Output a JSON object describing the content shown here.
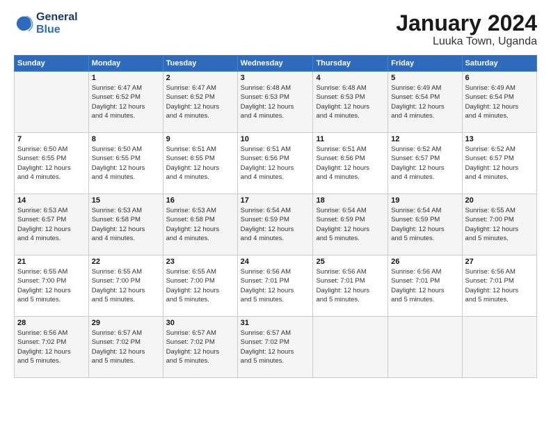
{
  "header": {
    "logo_line1": "General",
    "logo_line2": "Blue",
    "title": "January 2024",
    "subtitle": "Luuka Town, Uganda"
  },
  "days_of_week": [
    "Sunday",
    "Monday",
    "Tuesday",
    "Wednesday",
    "Thursday",
    "Friday",
    "Saturday"
  ],
  "weeks": [
    [
      {
        "day": "",
        "info": ""
      },
      {
        "day": "1",
        "info": "Sunrise: 6:47 AM\nSunset: 6:52 PM\nDaylight: 12 hours\nand 4 minutes."
      },
      {
        "day": "2",
        "info": "Sunrise: 6:47 AM\nSunset: 6:52 PM\nDaylight: 12 hours\nand 4 minutes."
      },
      {
        "day": "3",
        "info": "Sunrise: 6:48 AM\nSunset: 6:53 PM\nDaylight: 12 hours\nand 4 minutes."
      },
      {
        "day": "4",
        "info": "Sunrise: 6:48 AM\nSunset: 6:53 PM\nDaylight: 12 hours\nand 4 minutes."
      },
      {
        "day": "5",
        "info": "Sunrise: 6:49 AM\nSunset: 6:54 PM\nDaylight: 12 hours\nand 4 minutes."
      },
      {
        "day": "6",
        "info": "Sunrise: 6:49 AM\nSunset: 6:54 PM\nDaylight: 12 hours\nand 4 minutes."
      }
    ],
    [
      {
        "day": "7",
        "info": "Sunrise: 6:50 AM\nSunset: 6:55 PM\nDaylight: 12 hours\nand 4 minutes."
      },
      {
        "day": "8",
        "info": "Sunrise: 6:50 AM\nSunset: 6:55 PM\nDaylight: 12 hours\nand 4 minutes."
      },
      {
        "day": "9",
        "info": "Sunrise: 6:51 AM\nSunset: 6:55 PM\nDaylight: 12 hours\nand 4 minutes."
      },
      {
        "day": "10",
        "info": "Sunrise: 6:51 AM\nSunset: 6:56 PM\nDaylight: 12 hours\nand 4 minutes."
      },
      {
        "day": "11",
        "info": "Sunrise: 6:51 AM\nSunset: 6:56 PM\nDaylight: 12 hours\nand 4 minutes."
      },
      {
        "day": "12",
        "info": "Sunrise: 6:52 AM\nSunset: 6:57 PM\nDaylight: 12 hours\nand 4 minutes."
      },
      {
        "day": "13",
        "info": "Sunrise: 6:52 AM\nSunset: 6:57 PM\nDaylight: 12 hours\nand 4 minutes."
      }
    ],
    [
      {
        "day": "14",
        "info": "Sunrise: 6:53 AM\nSunset: 6:57 PM\nDaylight: 12 hours\nand 4 minutes."
      },
      {
        "day": "15",
        "info": "Sunrise: 6:53 AM\nSunset: 6:58 PM\nDaylight: 12 hours\nand 4 minutes."
      },
      {
        "day": "16",
        "info": "Sunrise: 6:53 AM\nSunset: 6:58 PM\nDaylight: 12 hours\nand 4 minutes."
      },
      {
        "day": "17",
        "info": "Sunrise: 6:54 AM\nSunset: 6:59 PM\nDaylight: 12 hours\nand 4 minutes."
      },
      {
        "day": "18",
        "info": "Sunrise: 6:54 AM\nSunset: 6:59 PM\nDaylight: 12 hours\nand 5 minutes."
      },
      {
        "day": "19",
        "info": "Sunrise: 6:54 AM\nSunset: 6:59 PM\nDaylight: 12 hours\nand 5 minutes."
      },
      {
        "day": "20",
        "info": "Sunrise: 6:55 AM\nSunset: 7:00 PM\nDaylight: 12 hours\nand 5 minutes."
      }
    ],
    [
      {
        "day": "21",
        "info": "Sunrise: 6:55 AM\nSunset: 7:00 PM\nDaylight: 12 hours\nand 5 minutes."
      },
      {
        "day": "22",
        "info": "Sunrise: 6:55 AM\nSunset: 7:00 PM\nDaylight: 12 hours\nand 5 minutes."
      },
      {
        "day": "23",
        "info": "Sunrise: 6:55 AM\nSunset: 7:00 PM\nDaylight: 12 hours\nand 5 minutes."
      },
      {
        "day": "24",
        "info": "Sunrise: 6:56 AM\nSunset: 7:01 PM\nDaylight: 12 hours\nand 5 minutes."
      },
      {
        "day": "25",
        "info": "Sunrise: 6:56 AM\nSunset: 7:01 PM\nDaylight: 12 hours\nand 5 minutes."
      },
      {
        "day": "26",
        "info": "Sunrise: 6:56 AM\nSunset: 7:01 PM\nDaylight: 12 hours\nand 5 minutes."
      },
      {
        "day": "27",
        "info": "Sunrise: 6:56 AM\nSunset: 7:01 PM\nDaylight: 12 hours\nand 5 minutes."
      }
    ],
    [
      {
        "day": "28",
        "info": "Sunrise: 6:56 AM\nSunset: 7:02 PM\nDaylight: 12 hours\nand 5 minutes."
      },
      {
        "day": "29",
        "info": "Sunrise: 6:57 AM\nSunset: 7:02 PM\nDaylight: 12 hours\nand 5 minutes."
      },
      {
        "day": "30",
        "info": "Sunrise: 6:57 AM\nSunset: 7:02 PM\nDaylight: 12 hours\nand 5 minutes."
      },
      {
        "day": "31",
        "info": "Sunrise: 6:57 AM\nSunset: 7:02 PM\nDaylight: 12 hours\nand 5 minutes."
      },
      {
        "day": "",
        "info": ""
      },
      {
        "day": "",
        "info": ""
      },
      {
        "day": "",
        "info": ""
      }
    ]
  ]
}
